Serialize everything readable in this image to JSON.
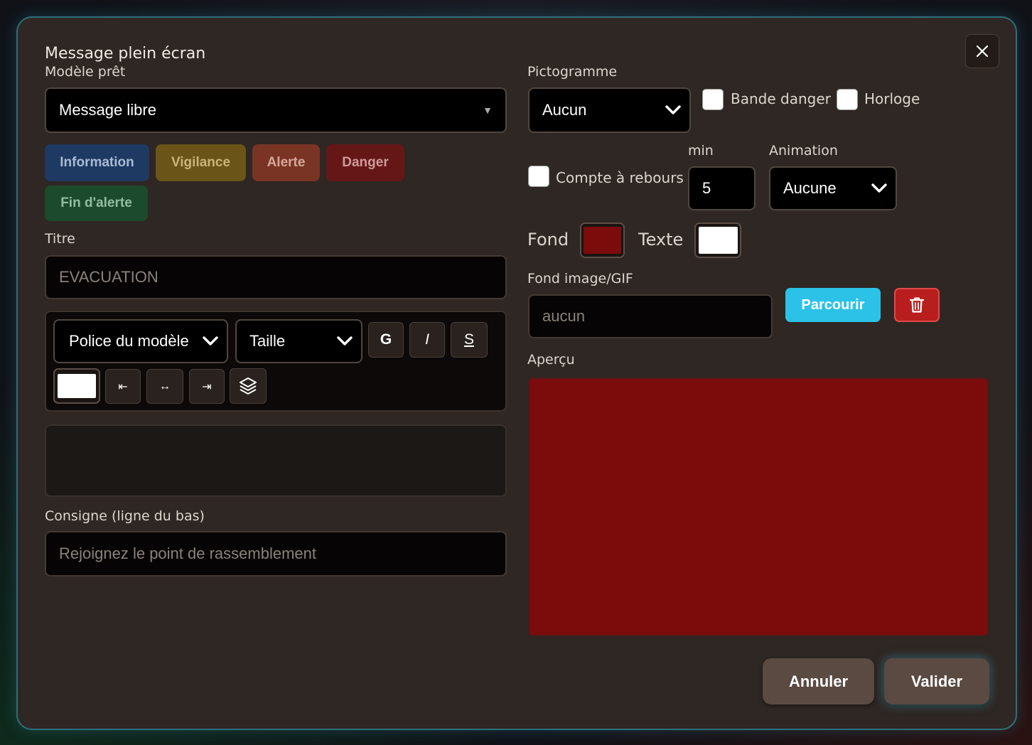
{
  "dialog": {
    "title": "Message plein écran",
    "close_icon": "close-icon"
  },
  "template": {
    "label": "Modèle prêt",
    "value": "Message libre"
  },
  "presets": [
    {
      "label": "Information",
      "bg": "#1e3a63",
      "fg": "#a9bbd3"
    },
    {
      "label": "Vigilance",
      "bg": "#6a5418",
      "fg": "#c8b47a"
    },
    {
      "label": "Alerte",
      "bg": "#7a3424",
      "fg": "#d5a89a"
    },
    {
      "label": "Danger",
      "bg": "#651717",
      "fg": "#cf9a9a"
    },
    {
      "label": "Fin d'alerte",
      "bg": "#1c4a2c",
      "fg": "#93bd9f"
    }
  ],
  "title_field": {
    "label": "Titre",
    "placeholder": "EVACUATION"
  },
  "toolbar": {
    "font_select": "Police du modèle",
    "size_select": "Taille",
    "bold": "G",
    "italic": "I",
    "strike": "S",
    "text_color": "#ffffff",
    "align_left": "⇤",
    "align_center": "↔",
    "align_right": "⇥",
    "layers_icon": "layers-icon"
  },
  "message_body": {
    "value": ""
  },
  "instruction_field": {
    "label": "Consigne (ligne du bas)",
    "placeholder": "Rejoignez le point de rassemblement"
  },
  "pictogram": {
    "label": "Pictogramme",
    "value": "Aucun"
  },
  "options": {
    "danger_band": "Bande danger",
    "clock": "Horloge",
    "countdown": "Compte à rebours"
  },
  "countdown": {
    "unit_label": "min",
    "value": "5"
  },
  "animation": {
    "label": "Animation",
    "value": "Aucune"
  },
  "colors": {
    "background_label": "Fond",
    "background_color": "#7c0b0b",
    "text_label": "Texte",
    "text_color": "#ffffff"
  },
  "bg_image": {
    "label": "Fond image/GIF",
    "placeholder": "aucun",
    "browse": "Parcourir",
    "delete_icon": "trash-icon"
  },
  "preview": {
    "label": "Aperçu",
    "bg": "#7c0b0b"
  },
  "actions": {
    "cancel": "Annuler",
    "confirm": "Valider"
  }
}
